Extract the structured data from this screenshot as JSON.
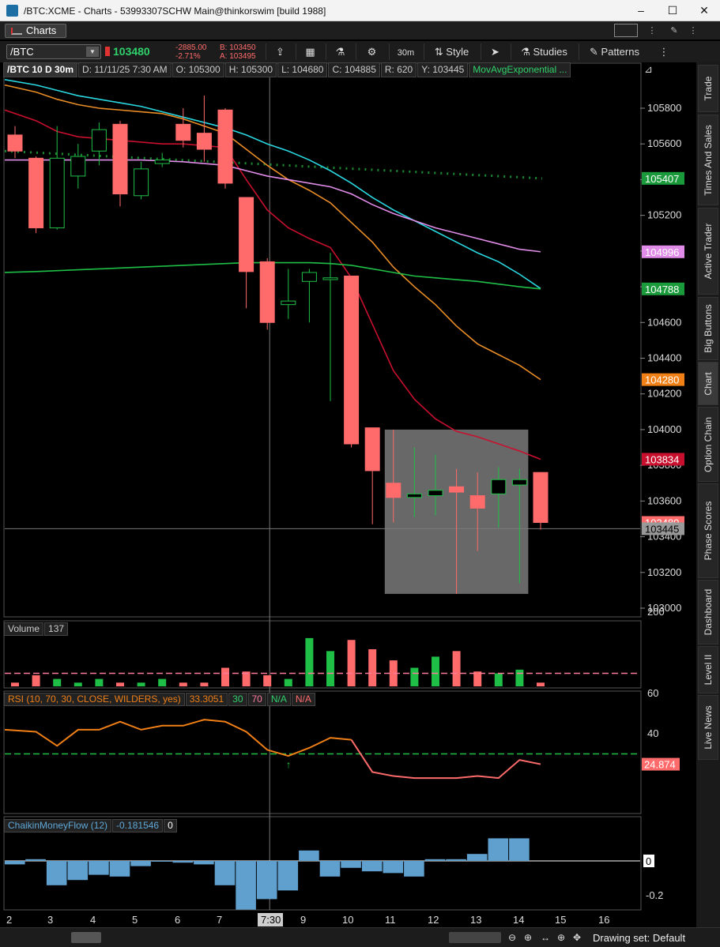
{
  "window": {
    "title": "/BTC:XCME - Charts - 53993307SCHW Main@thinkorswim [build 1988]",
    "minimize": "–",
    "maximize": "☐",
    "close": "✕"
  },
  "tabs": {
    "charts": "Charts"
  },
  "toolbar": {
    "symbol": "/BTC",
    "last": "103480",
    "change_abs": "-2885.00",
    "change_pct": "-2.71%",
    "bid": "B: 103450",
    "ask": "A: 103495",
    "timeframe": "30m",
    "style": "Style",
    "studies": "Studies",
    "patterns": "Patterns"
  },
  "info_bar": {
    "symbol": "/BTC 10 D 30m",
    "date": "D: 11/11/25 7:30 AM",
    "open": "O: 105300",
    "high": "H: 105300",
    "low": "L: 104680",
    "close": "C: 104885",
    "range": "R: 620",
    "y": "Y: 103445",
    "study": "MovAvgExponential ..."
  },
  "price_axis": {
    "ticks": [
      "105800",
      "105600",
      "105400",
      "105200",
      "105000",
      "104800",
      "104600",
      "104400",
      "104200",
      "104000",
      "103800",
      "103600",
      "103400",
      "103200",
      "103000"
    ],
    "badges": [
      {
        "label": "105407",
        "color": "#1a9a3a"
      },
      {
        "label": "104996",
        "color": "#e08ce8"
      },
      {
        "label": "104788",
        "color": "#1a9a3a"
      },
      {
        "label": "104280",
        "color": "#f07f16"
      },
      {
        "label": "103834",
        "color": "#c8102e"
      },
      {
        "label": "103480",
        "color": "#ff6b6b"
      },
      {
        "label": "103445",
        "color": "#999999"
      }
    ]
  },
  "volume": {
    "label": "Volume",
    "value": "137",
    "ticks": [
      "200"
    ]
  },
  "rsi": {
    "label": "RSI (10, 70, 30, CLOSE, WILDERS, yes)",
    "value": "33.3051",
    "overbought": "30",
    "oversold": "70",
    "na1": "N/A",
    "na2": "N/A",
    "ticks": [
      "60",
      "40"
    ],
    "badge": "24.874"
  },
  "cmf": {
    "label": "ChaikinMoneyFlow (12)",
    "value": "-0.181546",
    "zero": "0",
    "ticks": [
      "0",
      "-0.2"
    ]
  },
  "time_axis": {
    "labels": [
      "2",
      "3",
      "4",
      "5",
      "6",
      "7",
      "7:30",
      "9",
      "10",
      "11",
      "12",
      "13",
      "14",
      "15",
      "16"
    ]
  },
  "right_tabs": [
    "Trade",
    "Times And Sales",
    "Active Trader",
    "Big Buttons",
    "Chart",
    "Option Chain",
    "Phase Scores",
    "Dashboard",
    "Level II",
    "Live News"
  ],
  "status": {
    "drawing_set": "Drawing set: Default"
  },
  "chart_data": {
    "type": "candlestick",
    "candles": [
      {
        "o": 105650,
        "h": 105700,
        "l": 105520,
        "c": 105560
      },
      {
        "o": 105520,
        "h": 105530,
        "l": 105100,
        "c": 105130
      },
      {
        "o": 105130,
        "h": 105700,
        "l": 105120,
        "c": 105520
      },
      {
        "o": 105420,
        "h": 105600,
        "l": 105350,
        "c": 105530
      },
      {
        "o": 105560,
        "h": 105720,
        "l": 105480,
        "c": 105680
      },
      {
        "o": 105710,
        "h": 105730,
        "l": 105250,
        "c": 105320
      },
      {
        "o": 105310,
        "h": 105500,
        "l": 105290,
        "c": 105460
      },
      {
        "o": 105490,
        "h": 105550,
        "l": 105470,
        "c": 105510
      },
      {
        "o": 105710,
        "h": 105800,
        "l": 105580,
        "c": 105620
      },
      {
        "o": 105660,
        "h": 105870,
        "l": 105500,
        "c": 105570
      },
      {
        "o": 105790,
        "h": 105800,
        "l": 105350,
        "c": 105380
      },
      {
        "o": 105300,
        "h": 105300,
        "l": 104680,
        "c": 104885
      },
      {
        "o": 104940,
        "h": 104960,
        "l": 104560,
        "c": 104600
      },
      {
        "o": 104700,
        "h": 104900,
        "l": 104620,
        "c": 104720
      },
      {
        "o": 104830,
        "h": 104900,
        "l": 104600,
        "c": 104880
      },
      {
        "o": 104840,
        "h": 104990,
        "l": 104160,
        "c": 104850
      },
      {
        "o": 104860,
        "h": 104860,
        "l": 103900,
        "c": 103920
      },
      {
        "o": 104010,
        "h": 104010,
        "l": 103470,
        "c": 103770
      },
      {
        "o": 103700,
        "h": 104000,
        "l": 103480,
        "c": 103620
      },
      {
        "o": 103620,
        "h": 103900,
        "l": 103510,
        "c": 103640
      },
      {
        "o": 103630,
        "h": 103860,
        "l": 103520,
        "c": 103660
      },
      {
        "o": 103680,
        "h": 103780,
        "l": 103080,
        "c": 103650
      },
      {
        "o": 103630,
        "h": 103760,
        "l": 103320,
        "c": 103560
      },
      {
        "o": 103640,
        "h": 103790,
        "l": 103450,
        "c": 103720
      },
      {
        "o": 103690,
        "h": 103780,
        "l": 103140,
        "c": 103720
      },
      {
        "o": 103760,
        "h": 103760,
        "l": 103440,
        "c": 103480
      }
    ],
    "moving_averages": [
      {
        "color": "#2ad7e0",
        "values": [
          105960,
          105930,
          105900,
          105870,
          105850,
          105830,
          105810,
          105780,
          105750,
          105720,
          105690,
          105650,
          105600,
          105560,
          105510,
          105450,
          105380,
          105300,
          105230,
          105170,
          105110,
          105050,
          104990,
          104940,
          104870,
          104790
        ]
      },
      {
        "color": "#e98d26",
        "values": [
          105930,
          105890,
          105850,
          105820,
          105800,
          105790,
          105780,
          105770,
          105740,
          105700,
          105660,
          105570,
          105480,
          105400,
          105340,
          105270,
          105160,
          105050,
          104910,
          104800,
          104700,
          104580,
          104480,
          104420,
          104360,
          104280
        ]
      },
      {
        "color": "#c8102e",
        "values": [
          105790,
          105730,
          105670,
          105640,
          105630,
          105620,
          105610,
          105600,
          105600,
          105590,
          105580,
          105400,
          105230,
          105130,
          105070,
          105020,
          104850,
          104590,
          104330,
          104170,
          104060,
          103990,
          103960,
          103920,
          103880,
          103834
        ]
      },
      {
        "color": "#e08ce8",
        "values": [
          105510,
          105510,
          105510,
          105510,
          105510,
          105510,
          105510,
          105505,
          105500,
          105490,
          105480,
          105450,
          105420,
          105400,
          105380,
          105360,
          105320,
          105260,
          105210,
          105170,
          105130,
          105100,
          105070,
          105040,
          105010,
          104996
        ]
      },
      {
        "color": "#1fbf47",
        "values": [
          104880,
          104885,
          104890,
          104895,
          104900,
          104905,
          104910,
          104915,
          104920,
          104925,
          104930,
          104935,
          104935,
          104935,
          104935,
          104930,
          104920,
          104900,
          104880,
          104860,
          104850,
          104840,
          104830,
          104815,
          104800,
          104788
        ]
      }
    ],
    "dotted_line": {
      "color": "#1a8a32",
      "from": 105560,
      "to": 105407
    },
    "shaded_box": {
      "from_index": 18,
      "to_index": 24,
      "top": 104000,
      "bottom": 103080
    },
    "volume": [
      10,
      30,
      20,
      10,
      20,
      10,
      10,
      20,
      10,
      10,
      50,
      40,
      30,
      20,
      130,
      95,
      125,
      100,
      70,
      50,
      80,
      95,
      40,
      35,
      45,
      10
    ],
    "rsi": [
      42,
      41,
      34,
      42,
      42,
      46,
      42,
      44,
      44,
      47,
      46,
      41,
      32,
      29,
      33,
      38,
      37,
      21,
      19,
      18,
      18,
      18,
      19,
      18,
      27,
      24.874
    ],
    "cmf": [
      -0.02,
      0.01,
      -0.14,
      -0.11,
      -0.08,
      -0.09,
      -0.03,
      0.0,
      -0.01,
      -0.02,
      -0.14,
      -0.28,
      -0.22,
      -0.17,
      0.06,
      -0.09,
      -0.04,
      -0.06,
      -0.07,
      -0.09,
      0.01,
      0.01,
      0.04,
      0.13,
      0.13,
      -0.181546
    ],
    "ylim": [
      103000,
      105800
    ],
    "rsi_levels": [
      70,
      30
    ]
  }
}
